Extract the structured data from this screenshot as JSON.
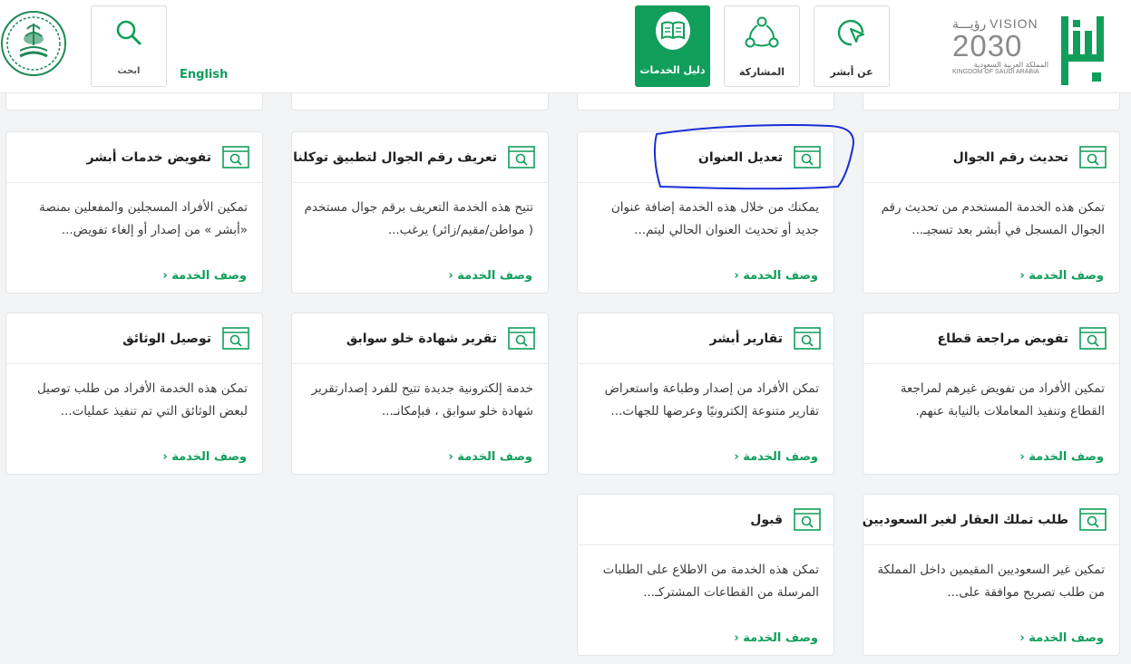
{
  "header": {
    "lang_link": "English",
    "nav": {
      "search": "ابحث",
      "services_guide": "دليل الخدمات",
      "participation": "المشاركة",
      "about": "عن أبشر"
    },
    "vision_logo": {
      "line1": "رؤيـــة VISION",
      "year": "2030",
      "ar": "المملكة العربية السعودية",
      "en": "KINGDOM OF SAUDI ARABIA"
    },
    "absher_logo": "أبشر"
  },
  "cards": [
    {
      "title": "تحديث رقم الجوال",
      "desc": "تمكن هذه الخدمة المستخدم من تحديث رقم الجوال المسجل في أبشر بعد تسجيـ...",
      "link": "وصف الخدمة ‹"
    },
    {
      "title": "تعديل العنوان",
      "desc": "يمكنك من خلال هذه الخدمة إضافة عنوان جديد أو تحديث العنوان الحالي ليتم...",
      "link": "وصف الخدمة ‹"
    },
    {
      "title": "تعريف رقم الجوال لتطبيق توكلنا",
      "desc": "تتيح هذه الخدمة التعريف برقم جوال مستخدم ( مواطن/مقيم/زائر) يرغب...",
      "link": "وصف الخدمة ‹"
    },
    {
      "title": "تفويض خدمات أبشر",
      "desc": "تمكين الأفراد المسجلين والمفعلين بمنصة «أبشر » من إصدار أو إلغاء تفويض...",
      "link": "وصف الخدمة ‹"
    },
    {
      "title": "تفويض مراجعة قطاع",
      "desc": "تمكين الأفراد من تفويض غيرهم لمراجعة القطاع وتنفيذ المعاملات بالنيابة عنهم.",
      "link": "وصف الخدمة ‹"
    },
    {
      "title": "تقارير أبشر",
      "desc": "تمكن الأفراد من إصدار وطباعة واستعراض تقارير متنوعة إلكترونيًا وعرضها للجهات...",
      "link": "وصف الخدمة ‹"
    },
    {
      "title": "تقرير شهادة خلو سوابق",
      "desc": "خدمة إلكترونية جديدة تتيح للفرد إصدارتقرير شهادة خلو سوابق ، فبإمكانـ...",
      "link": "وصف الخدمة ‹"
    },
    {
      "title": "توصيل الوثائق",
      "desc": "تمكن هذه الخدمة الأفراد من طلب توصيل لبعض الوثائق التي تم تنفيذ عمليات...",
      "link": "وصف الخدمة ‹"
    },
    {
      "title": "طلب تملك العقار لغير السعوديين",
      "desc": "تمكين غير السعوديين المقيمين داخل المملكة من طلب تصريح موافقة على...",
      "link": "وصف الخدمة ‹"
    },
    {
      "title": "قبول",
      "desc": "تمكن هذه الخدمة من الاطلاع على الطلبات المرسلة من القطاعات المشتركـ...",
      "link": "وصف الخدمة ‹"
    }
  ],
  "colors": {
    "accent": "#109e5a",
    "annotation": "#1a2fd6"
  }
}
